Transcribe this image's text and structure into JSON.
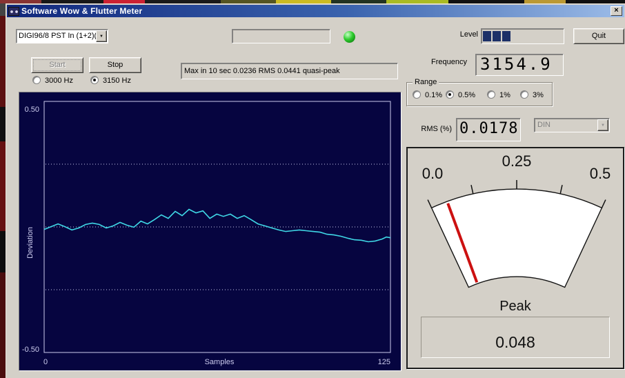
{
  "window": {
    "title": "Software Wow & Flutter Meter"
  },
  "icons": {
    "close": "×",
    "dropdown": "▼"
  },
  "device": {
    "value": "DIGI96/8 PST In (1+2)("
  },
  "monitor": {
    "field_value": "",
    "led_color": "#2ecc2e"
  },
  "level": {
    "label": "Level",
    "filled": 3,
    "total": 8,
    "segment_color": "#1c3068"
  },
  "quit": {
    "label": "Quit"
  },
  "transport": {
    "start": "Start",
    "stop": "Stop"
  },
  "test_freq": {
    "options": [
      {
        "label": "3000 Hz",
        "selected": false
      },
      {
        "label": "3150 Hz",
        "selected": true
      }
    ]
  },
  "status": {
    "text": "Max in 10 sec 0.0236 RMS 0.0441 quasi-peak"
  },
  "frequency": {
    "label": "Frequency",
    "value": "3154.9"
  },
  "range": {
    "label": "Range",
    "options": [
      {
        "label": "0.1%",
        "selected": false
      },
      {
        "label": "0.5%",
        "selected": true
      },
      {
        "label": "1%",
        "selected": false
      },
      {
        "label": "3%",
        "selected": false
      }
    ]
  },
  "rms": {
    "label": "RMS (%)",
    "value": "0.0178"
  },
  "weighting": {
    "value": "DIN",
    "disabled": true
  },
  "chart_data": {
    "type": "line",
    "title": "",
    "xlabel": "Samples",
    "ylabel": "Deviation",
    "xlim": [
      0,
      125
    ],
    "ylim": [
      -0.5,
      0.5
    ],
    "xtick_labels": [
      "0",
      "125"
    ],
    "ytick_labels": [
      "0.50",
      "-0.50"
    ],
    "gridlines_y": [
      0.25,
      0,
      -0.25
    ],
    "bg_color": "#060540",
    "axis_color": "#ccccee",
    "line_color": "#3fd8e6",
    "x": [
      0,
      2.5,
      5,
      7.5,
      10,
      12.5,
      15,
      17.4,
      19.9,
      22.4,
      24.9,
      27.4,
      29.9,
      32.4,
      34.9,
      37.3,
      39.8,
      42.3,
      44.8,
      47.3,
      49.8,
      52.3,
      54.8,
      57.3,
      59.8,
      62.3,
      64.7,
      67.2,
      69.7,
      72.2,
      74.7,
      77.2,
      79.7,
      82.2,
      84.7,
      87.2,
      89.6,
      92.1,
      94.6,
      97.1,
      99.6,
      102.1,
      104.6,
      107.1,
      109.6,
      112,
      114.5,
      117,
      119.5,
      122,
      123.5,
      125
    ],
    "y": [
      -0.01,
      0.001,
      0.012,
      0.001,
      -0.012,
      -0.004,
      0.01,
      0.015,
      0.01,
      -0.004,
      0.004,
      0.018,
      0.007,
      -0.001,
      0.023,
      0.012,
      0.029,
      0.048,
      0.034,
      0.062,
      0.045,
      0.07,
      0.056,
      0.064,
      0.034,
      0.051,
      0.042,
      0.051,
      0.034,
      0.045,
      0.029,
      0.012,
      0.004,
      -0.004,
      -0.012,
      -0.018,
      -0.015,
      -0.012,
      -0.015,
      -0.018,
      -0.021,
      -0.029,
      -0.032,
      -0.037,
      -0.045,
      -0.051,
      -0.053,
      -0.059,
      -0.056,
      -0.048,
      -0.04,
      -0.043
    ]
  },
  "meter": {
    "type": "gauge",
    "min": 0,
    "max": 0.5,
    "value": 0.048,
    "ticks": [
      0,
      0.125,
      0.25,
      0.375,
      0.5
    ],
    "tick_labels": [
      "0.0",
      "0.25",
      "0.5"
    ],
    "needle_color": "#cc1111",
    "peak_label": "Peak",
    "peak_value": "0.048"
  }
}
